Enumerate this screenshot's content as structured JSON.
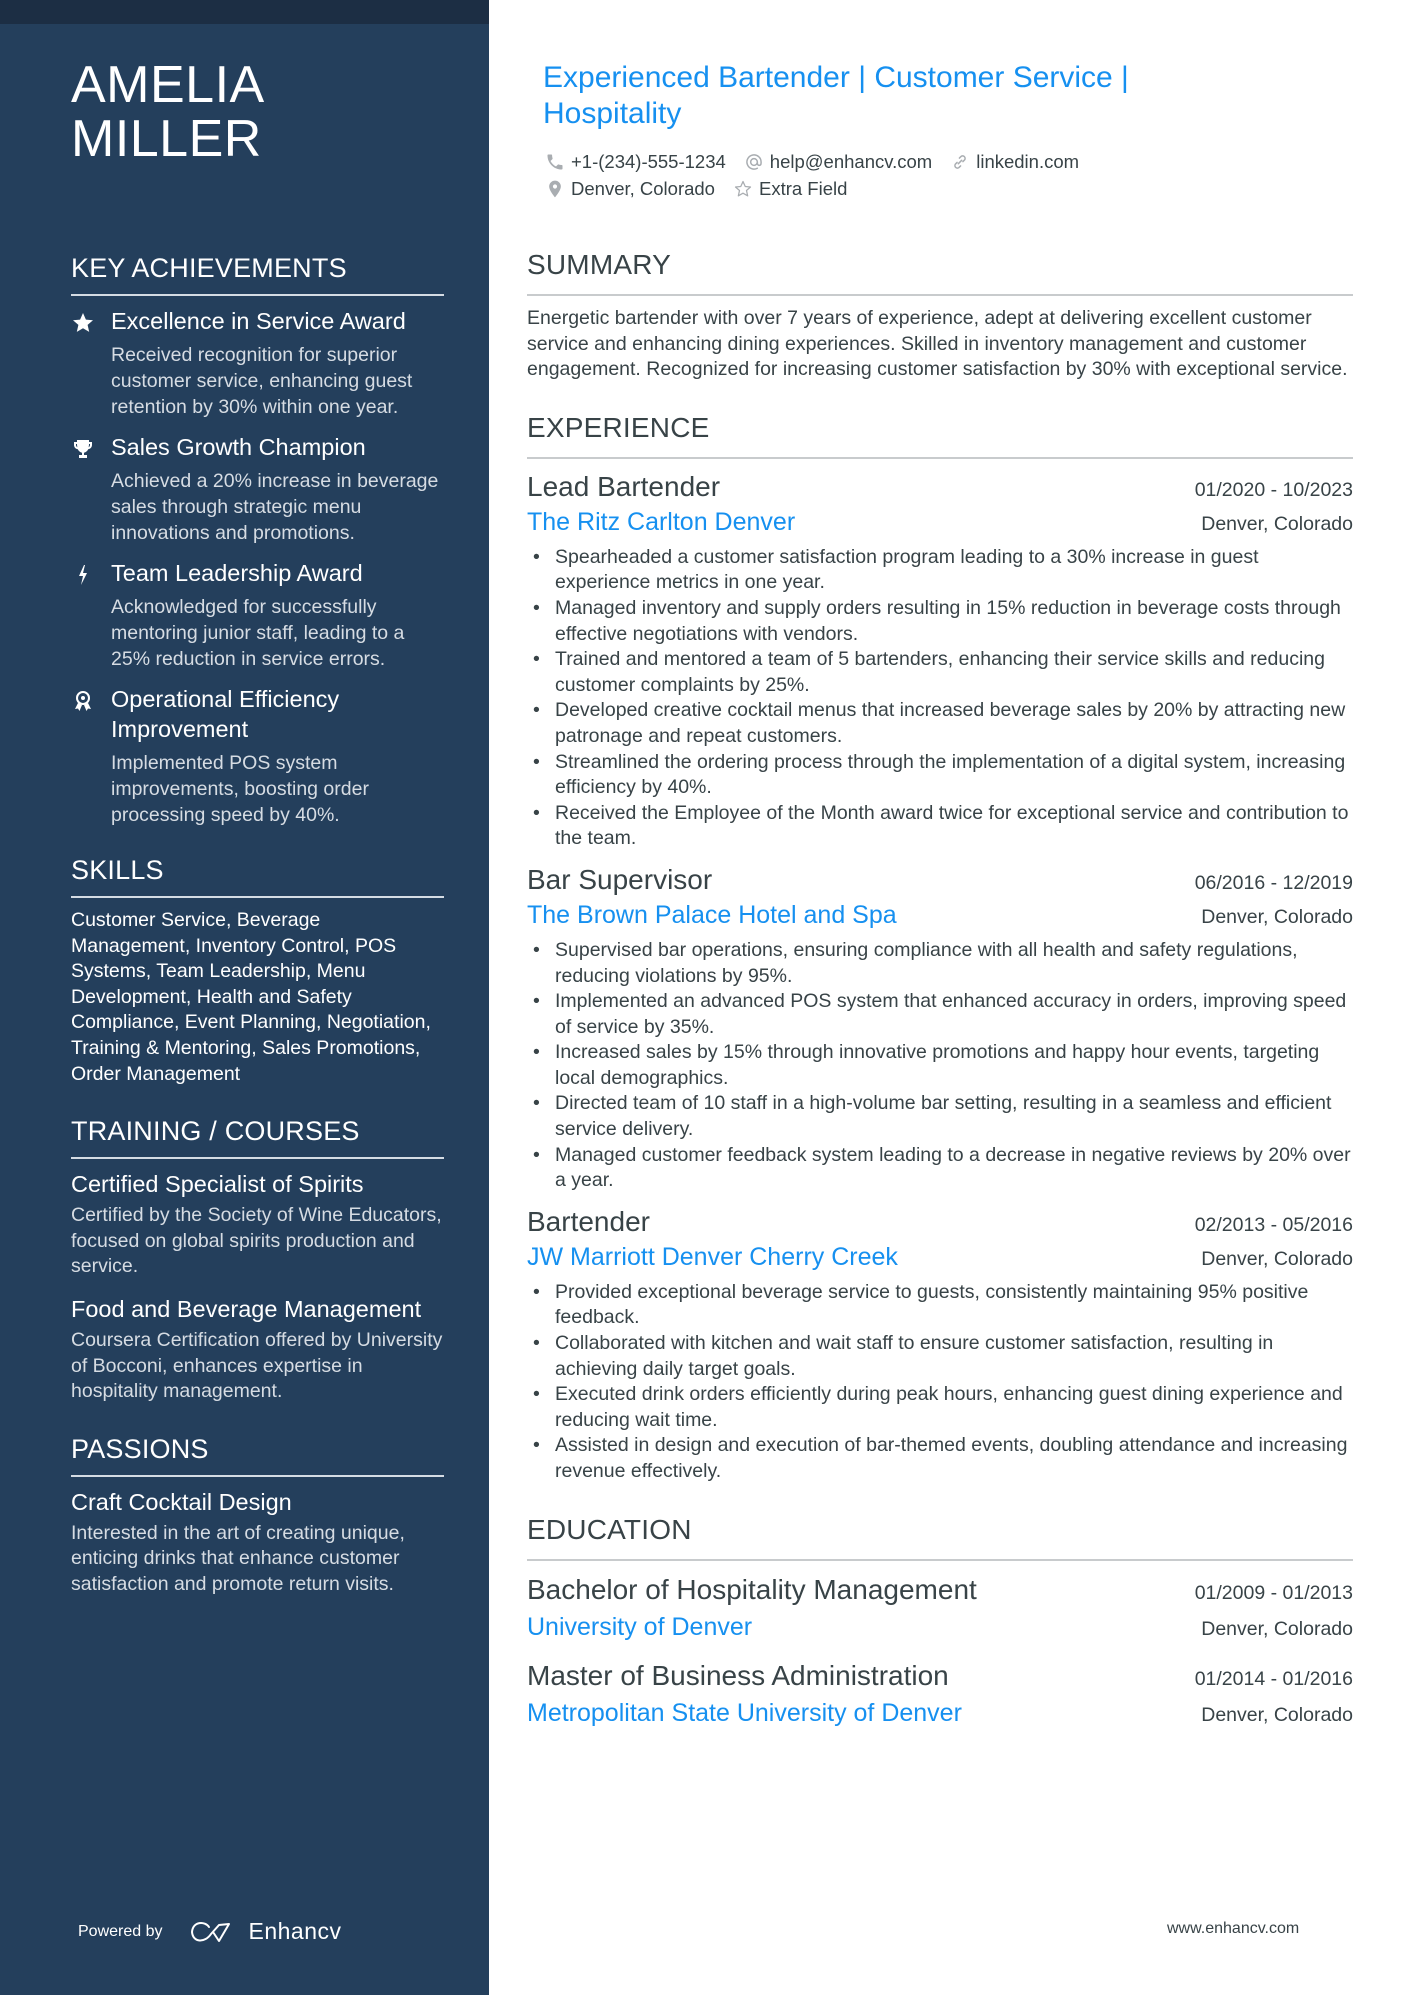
{
  "name": "AMELIA MILLER",
  "headline": "Experienced Bartender | Customer Service | Hospitality",
  "contacts": {
    "phone": "+1-(234)-555-1234",
    "email": "help@enhancv.com",
    "link": "linkedin.com",
    "location": "Denver, Colorado",
    "extra": "Extra Field"
  },
  "sidebar": {
    "key_achievements": {
      "heading": "KEY ACHIEVEMENTS",
      "items": [
        {
          "icon": "star-icon",
          "title": "Excellence in Service Award",
          "desc": "Received recognition for superior customer service, enhancing guest retention by 30% within one year."
        },
        {
          "icon": "trophy-icon",
          "title": "Sales Growth Champion",
          "desc": "Achieved a 20% increase in beverage sales through strategic menu innovations and promotions."
        },
        {
          "icon": "lightning-icon",
          "title": "Team Leadership Award",
          "desc": "Acknowledged for successfully mentoring junior staff, leading to a 25% reduction in service errors."
        },
        {
          "icon": "medal-icon",
          "title": "Operational Efficiency Improvement",
          "desc": "Implemented POS system improvements, boosting order processing speed by 40%."
        }
      ]
    },
    "skills": {
      "heading": "SKILLS",
      "text": "Customer Service, Beverage Management, Inventory Control, POS Systems, Team Leadership, Menu Development, Health and Safety Compliance, Event Planning, Negotiation, Training & Mentoring, Sales Promotions, Order Management"
    },
    "training": {
      "heading": "TRAINING / COURSES",
      "items": [
        {
          "title": "Certified Specialist of Spirits",
          "desc": "Certified by the Society of Wine Educators, focused on global spirits production and service."
        },
        {
          "title": "Food and Beverage Management",
          "desc": "Coursera Certification offered by University of Bocconi, enhances expertise in hospitality management."
        }
      ]
    },
    "passions": {
      "heading": "PASSIONS",
      "items": [
        {
          "title": "Craft Cocktail Design",
          "desc": "Interested in the art of creating unique, enticing drinks that enhance customer satisfaction and promote return visits."
        }
      ]
    },
    "powered_by": "Powered by",
    "brand": "Enhancv"
  },
  "main": {
    "summary": {
      "heading": "SUMMARY",
      "text": "Energetic bartender with over 7 years of experience, adept at delivering excellent customer service and enhancing dining experiences. Skilled in inventory management and customer engagement. Recognized for increasing customer satisfaction by 30% with exceptional service."
    },
    "experience": {
      "heading": "EXPERIENCE",
      "jobs": [
        {
          "role": "Lead Bartender",
          "dates": "01/2020 - 10/2023",
          "company": "The Ritz Carlton Denver",
          "location": "Denver, Colorado",
          "bullets": [
            "Spearheaded a customer satisfaction program leading to a 30% increase in guest experience metrics in one year.",
            "Managed inventory and supply orders resulting in 15% reduction in beverage costs through effective negotiations with vendors.",
            "Trained and mentored a team of 5 bartenders, enhancing their service skills and reducing customer complaints by 25%.",
            "Developed creative cocktail menus that increased beverage sales by 20% by attracting new patronage and repeat customers.",
            "Streamlined the ordering process through the implementation of a digital system, increasing efficiency by 40%.",
            "Received the Employee of the Month award twice for exceptional service and contribution to the team."
          ]
        },
        {
          "role": "Bar Supervisor",
          "dates": "06/2016 - 12/2019",
          "company": "The Brown Palace Hotel and Spa",
          "location": "Denver, Colorado",
          "bullets": [
            "Supervised bar operations, ensuring compliance with all health and safety regulations, reducing violations by 95%.",
            "Implemented an advanced POS system that enhanced accuracy in orders, improving speed of service by 35%.",
            "Increased sales by 15% through innovative promotions and happy hour events, targeting local demographics.",
            "Directed team of 10 staff in a high-volume bar setting, resulting in a seamless and efficient service delivery.",
            "Managed customer feedback system leading to a decrease in negative reviews by 20% over a year."
          ]
        },
        {
          "role": "Bartender",
          "dates": "02/2013 - 05/2016",
          "company": "JW Marriott Denver Cherry Creek",
          "location": "Denver, Colorado",
          "bullets": [
            "Provided exceptional beverage service to guests, consistently maintaining 95% positive feedback.",
            "Collaborated with kitchen and wait staff to ensure customer satisfaction, resulting in achieving daily target goals.",
            "Executed drink orders efficiently during peak hours, enhancing guest dining experience and reducing wait time.",
            "Assisted in design and execution of bar-themed events, doubling attendance and increasing revenue effectively."
          ]
        }
      ]
    },
    "education": {
      "heading": "EDUCATION",
      "items": [
        {
          "degree": "Bachelor of Hospitality Management",
          "dates": "01/2009 - 01/2013",
          "school": "University of Denver",
          "location": "Denver, Colorado"
        },
        {
          "degree": "Master of Business Administration",
          "dates": "01/2014 - 01/2016",
          "school": "Metropolitan State University of Denver",
          "location": "Denver, Colorado"
        }
      ]
    }
  },
  "footer_url": "www.enhancv.com",
  "colors": {
    "sidebar_bg": "#243F5C",
    "sidebar_top": "#1C2E44",
    "accent": "#1690F0",
    "text": "#384347"
  }
}
